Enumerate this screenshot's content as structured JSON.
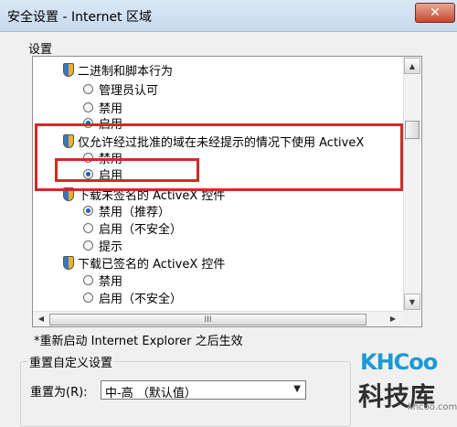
{
  "window": {
    "title": "安全设置 - Internet 区域",
    "close_glyph": "✕"
  },
  "settings": {
    "label": "设置",
    "groups": [
      {
        "heading": "二进制和脚本行为",
        "icon": "shield-icon",
        "options": [
          {
            "label": "管理员认可",
            "checked": false
          },
          {
            "label": "禁用",
            "checked": false
          },
          {
            "label": "启用",
            "checked": true
          }
        ]
      },
      {
        "heading": "仅允许经过批准的域在未经提示的情况下使用 ActiveX",
        "icon": "shield-icon",
        "options": [
          {
            "label": "禁用",
            "checked": false
          },
          {
            "label": "启用",
            "checked": true
          }
        ]
      },
      {
        "heading": "下载未签名的 ActiveX 控件",
        "icon": "shield-icon",
        "options": [
          {
            "label": "禁用（推荐）",
            "checked": true
          },
          {
            "label": "启用（不安全）",
            "checked": false
          },
          {
            "label": "提示",
            "checked": false
          }
        ]
      },
      {
        "heading": "下载已签名的 ActiveX 控件",
        "icon": "shield-icon",
        "options": [
          {
            "label": "禁用",
            "checked": false
          },
          {
            "label": "启用（不安全）",
            "checked": false
          }
        ]
      }
    ],
    "hscroll_grip": "III",
    "scroll_up": "▲",
    "scroll_down": "▼",
    "scroll_left": "◀",
    "scroll_right": "▶"
  },
  "restart_note": "*重新启动 Internet Explorer 之后生效",
  "reset": {
    "group_label": "重置自定义设置",
    "label": "重置为(R):",
    "selected": "中-高 （默认值）"
  },
  "watermark": {
    "logo": "KHCoo",
    "name": "科技库",
    "url": "khcoo.com"
  },
  "colors": {
    "highlight": "#d12a2a",
    "close_button": "#c7472e",
    "watermark_blue": "#1b9ad6"
  }
}
